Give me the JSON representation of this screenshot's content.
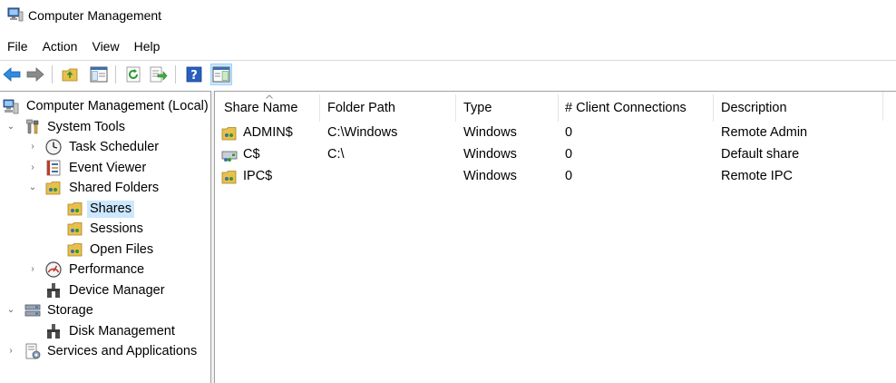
{
  "window": {
    "title": "Computer Management"
  },
  "menu": [
    "File",
    "Action",
    "View",
    "Help"
  ],
  "toolbar": {
    "buttons": [
      "back-icon",
      "forward-icon",
      "up-folder-icon",
      "show-hide-tree-icon",
      "refresh-icon",
      "export-list-icon",
      "help-icon",
      "show-hide-action-pane-icon"
    ]
  },
  "tree": {
    "root": "Computer Management (Local)",
    "system_tools": "System Tools",
    "task_scheduler": "Task Scheduler",
    "event_viewer": "Event Viewer",
    "shared_folders": "Shared Folders",
    "shares": "Shares",
    "sessions": "Sessions",
    "open_files": "Open Files",
    "performance": "Performance",
    "device_manager": "Device Manager",
    "storage": "Storage",
    "disk_management": "Disk Management",
    "services_apps": "Services and Applications"
  },
  "list": {
    "columns": [
      "Share Name",
      "Folder Path",
      "Type",
      "# Client Connections",
      "Description"
    ],
    "sort_column": "Share Name",
    "rows": [
      {
        "name": "ADMIN$",
        "path": "C:\\Windows",
        "type": "Windows",
        "connections": "0",
        "description": "Remote Admin"
      },
      {
        "name": "C$",
        "path": "C:\\",
        "type": "Windows",
        "connections": "0",
        "description": "Default share"
      },
      {
        "name": "IPC$",
        "path": "",
        "type": "Windows",
        "connections": "0",
        "description": "Remote IPC"
      }
    ]
  },
  "colors": {
    "selection": "#cce8ff",
    "selection_border": "#99d1ff",
    "folder": "#e8c04a",
    "accent_blue": "#1e6fd0"
  }
}
